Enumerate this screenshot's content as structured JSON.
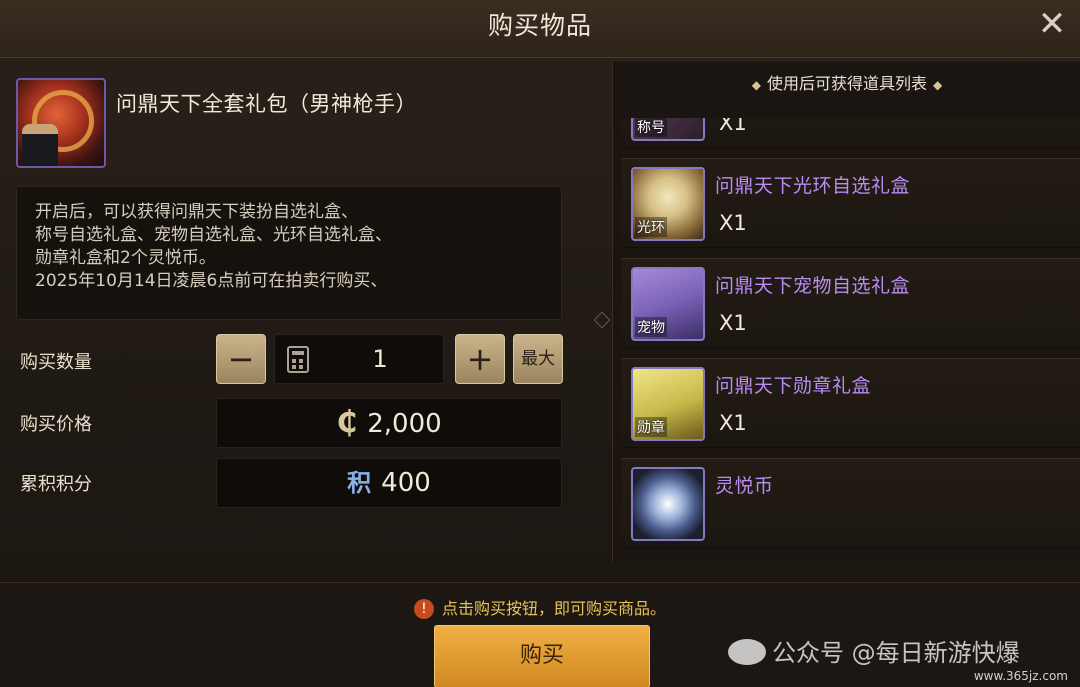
{
  "window": {
    "title": "购买物品",
    "close_symbol": "✕"
  },
  "item": {
    "name": "问鼎天下全套礼包（男神枪手）",
    "description_lines": [
      "开启后，可以获得问鼎天下装扮自选礼盒、",
      "称号自选礼盒、宠物自选礼盒、光环自选礼盒、",
      "勋章礼盒和2个灵悦币。",
      "2025年10月14日凌晨6点前可在拍卖行购买、"
    ]
  },
  "quantity": {
    "label": "购买数量",
    "minus": "−",
    "plus": "+",
    "max_label": "最大",
    "value": "1",
    "icon": "calculator-icon"
  },
  "price": {
    "label": "购买价格",
    "currency_icon": "₵",
    "value": "2,000"
  },
  "points": {
    "label": "累积积分",
    "icon_text": "积",
    "value": "400"
  },
  "rewards": {
    "header": "使用后可获得道具列表",
    "partial_tag": "称号",
    "partial_qty": "X1",
    "items": [
      {
        "name": "问鼎天下光环自选礼盒",
        "qty": "X1",
        "tag": "光环",
        "icon": "halo-box-icon"
      },
      {
        "name": "问鼎天下宠物自选礼盒",
        "qty": "X1",
        "tag": "宠物",
        "icon": "pet-box-icon"
      },
      {
        "name": "问鼎天下勋章礼盒",
        "qty": "X1",
        "tag": "勋章",
        "icon": "medal-box-icon"
      },
      {
        "name": "灵悦币",
        "qty": "",
        "tag": "",
        "icon": "coin-icon"
      }
    ]
  },
  "footer": {
    "notice": "点击购买按钮，即可购买商品。",
    "buy_label": "购买"
  },
  "watermark": {
    "text": "公众号 @每日新游快爆",
    "url": "www.365jz.com"
  },
  "colors": {
    "accent_gold": "#e8c25a",
    "item_purple": "#b88cf0",
    "buy_button": "#e09a30"
  }
}
